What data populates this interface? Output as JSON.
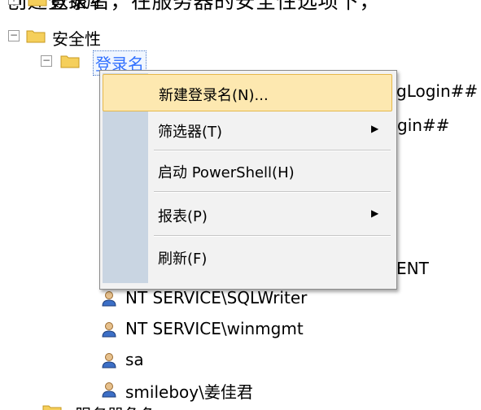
{
  "caption_text": "创建登录名，在服务器的安全性选项下，",
  "tree": {
    "partial_top_label": "数据库",
    "security_node": "安全性",
    "logins_node": "登录名",
    "hidden_logins_partial": [
      "##MS_PolicyTsqlExecutionLogin##",
      "##MS_PolicyEventProcessingLogin##"
    ],
    "login_partial_right_1": "gLogin##",
    "login_partial_right_2": "gin##",
    "login_partial_right_3": "ENT",
    "logins": [
      "NT SERVICE\\SQLWriter",
      "NT SERVICE\\winmgmt",
      "sa",
      "smileboy\\姜佳君"
    ],
    "bottom_partial": "服务器角色"
  },
  "context_menu": {
    "items": [
      {
        "label": "新建登录名(N)...",
        "highlighted": true,
        "submenu": false
      },
      {
        "label": "筛选器(T)",
        "highlighted": false,
        "submenu": true
      },
      {
        "label": "启动 PowerShell(H)",
        "highlighted": false,
        "submenu": false
      },
      {
        "label": "报表(P)",
        "highlighted": false,
        "submenu": true
      },
      {
        "label": "刷新(F)",
        "highlighted": false,
        "submenu": false
      }
    ],
    "submenu_arrow": "▶"
  },
  "colors": {
    "menu_highlight": "#fde8b0",
    "menu_gutter": "#c9d5e2",
    "selection_text": "#3070ff"
  }
}
